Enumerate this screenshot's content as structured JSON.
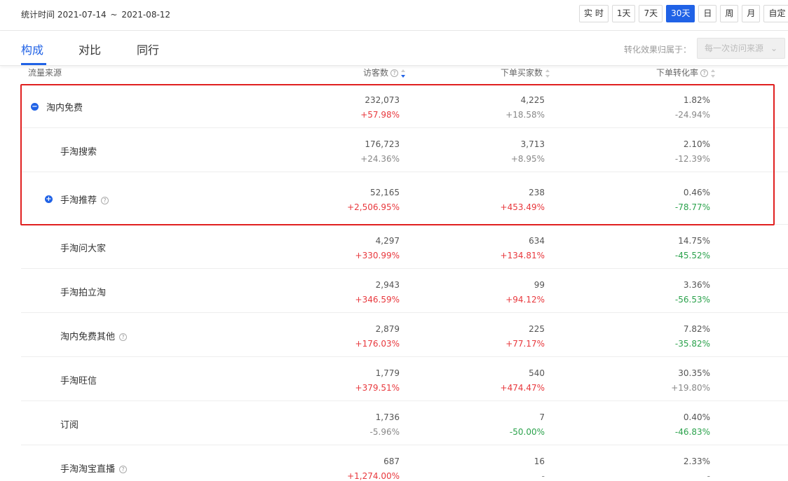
{
  "stat_time": {
    "label": "统计时间",
    "start": "2021-07-14",
    "sep": "~",
    "end": "2021-08-12"
  },
  "range_buttons": [
    {
      "label": "实 时",
      "active": false
    },
    {
      "label": "1天",
      "active": false
    },
    {
      "label": "7天",
      "active": false
    },
    {
      "label": "30天",
      "active": true
    },
    {
      "label": "日",
      "active": false
    },
    {
      "label": "周",
      "active": false
    },
    {
      "label": "月",
      "active": false
    },
    {
      "label": "自定",
      "active": false
    }
  ],
  "tabs": [
    {
      "label": "构成",
      "active": true
    },
    {
      "label": "对比",
      "active": false
    },
    {
      "label": "同行",
      "active": false
    }
  ],
  "attribution": {
    "label": "转化效果归属于：",
    "value": "每一次访问来源"
  },
  "columns": {
    "source": "流量来源",
    "visitors": "访客数",
    "buyers": "下单买家数",
    "rate": "下单转化率"
  },
  "rows": [
    {
      "name": "淘内免费",
      "toggle": "minus",
      "help": false,
      "visitors": "232,073",
      "visitors_change": "+57.98%",
      "visitors_color": "red",
      "buyers": "4,225",
      "buyers_change": "+18.58%",
      "buyers_color": "gray",
      "rate": "1.82%",
      "rate_change": "-24.94%",
      "rate_color": "gray"
    },
    {
      "name": "手淘搜索",
      "toggle": "",
      "help": false,
      "visitors": "176,723",
      "visitors_change": "+24.36%",
      "visitors_color": "gray",
      "buyers": "3,713",
      "buyers_change": "+8.95%",
      "buyers_color": "gray",
      "rate": "2.10%",
      "rate_change": "-12.39%",
      "rate_color": "gray"
    },
    {
      "name": "手淘推荐",
      "toggle": "plus",
      "help": true,
      "visitors": "52,165",
      "visitors_change": "+2,506.95%",
      "visitors_color": "red",
      "buyers": "238",
      "buyers_change": "+453.49%",
      "buyers_color": "red",
      "rate": "0.46%",
      "rate_change": "-78.77%",
      "rate_color": "green"
    },
    {
      "name": "手淘问大家",
      "toggle": "",
      "help": false,
      "visitors": "4,297",
      "visitors_change": "+330.99%",
      "visitors_color": "red",
      "buyers": "634",
      "buyers_change": "+134.81%",
      "buyers_color": "red",
      "rate": "14.75%",
      "rate_change": "-45.52%",
      "rate_color": "green"
    },
    {
      "name": "手淘拍立淘",
      "toggle": "",
      "help": false,
      "visitors": "2,943",
      "visitors_change": "+346.59%",
      "visitors_color": "red",
      "buyers": "99",
      "buyers_change": "+94.12%",
      "buyers_color": "red",
      "rate": "3.36%",
      "rate_change": "-56.53%",
      "rate_color": "green"
    },
    {
      "name": "淘内免费其他",
      "toggle": "",
      "help": true,
      "visitors": "2,879",
      "visitors_change": "+176.03%",
      "visitors_color": "red",
      "buyers": "225",
      "buyers_change": "+77.17%",
      "buyers_color": "red",
      "rate": "7.82%",
      "rate_change": "-35.82%",
      "rate_color": "green"
    },
    {
      "name": "手淘旺信",
      "toggle": "",
      "help": false,
      "visitors": "1,779",
      "visitors_change": "+379.51%",
      "visitors_color": "red",
      "buyers": "540",
      "buyers_change": "+474.47%",
      "buyers_color": "red",
      "rate": "30.35%",
      "rate_change": "+19.80%",
      "rate_color": "gray"
    },
    {
      "name": "订阅",
      "toggle": "",
      "help": false,
      "visitors": "1,736",
      "visitors_change": "-5.96%",
      "visitors_color": "gray",
      "buyers": "7",
      "buyers_change": "-50.00%",
      "buyers_color": "green",
      "rate": "0.40%",
      "rate_change": "-46.83%",
      "rate_color": "green"
    },
    {
      "name": "手淘淘宝直播",
      "toggle": "",
      "help": true,
      "visitors": "687",
      "visitors_change": "+1,274.00%",
      "visitors_color": "red",
      "buyers": "16",
      "buyers_change": "-",
      "buyers_color": "gray",
      "rate": "2.33%",
      "rate_change": "-",
      "rate_color": "gray"
    }
  ],
  "colors": {
    "accent": "#2062e6",
    "up": "#e8383d",
    "down": "#2ba24c",
    "highlight": "#e02020"
  },
  "icons": {
    "help": "question-circle-icon",
    "collapse": "minus-circle-icon",
    "expand": "plus-circle-icon",
    "sort": "sort-arrows-icon",
    "dropdown": "chevron-down-icon"
  }
}
